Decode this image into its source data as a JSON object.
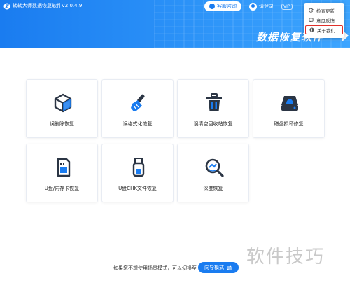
{
  "app": {
    "title": "转转大师数据恢复软件V2.0.4.9",
    "hero_title": "数据恢复软件"
  },
  "header": {
    "consult_label": "客服咨询",
    "login_label": "请登录",
    "vip_label": "VIP"
  },
  "menu": {
    "items": [
      {
        "label": "检查更新",
        "icon": "refresh-icon"
      },
      {
        "label": "意见反馈",
        "icon": "feedback-icon"
      },
      {
        "label": "关于我们",
        "icon": "info-icon",
        "selected": true
      }
    ]
  },
  "modes": [
    {
      "label": "误删除恢复",
      "icon": "cube-icon"
    },
    {
      "label": "误格式化恢复",
      "icon": "broom-icon"
    },
    {
      "label": "误清空回收站恢复",
      "icon": "trash-icon"
    },
    {
      "label": "磁盘损坏修复",
      "icon": "disk-icon"
    },
    {
      "label": "U盘/内存卡恢复",
      "icon": "sdcard-icon"
    },
    {
      "label": "U盘CHK文件恢复",
      "icon": "usb-icon"
    },
    {
      "label": "深度恢复",
      "icon": "deep-search-icon"
    }
  ],
  "footer": {
    "hint": "如果您不想使用场景模式，可以切换至",
    "wizard_label": "向导模式"
  },
  "watermark": "软件技巧",
  "colors": {
    "primary": "#1a7cf0",
    "icon_dark": "#2b3544",
    "highlight": "#e0302a"
  }
}
